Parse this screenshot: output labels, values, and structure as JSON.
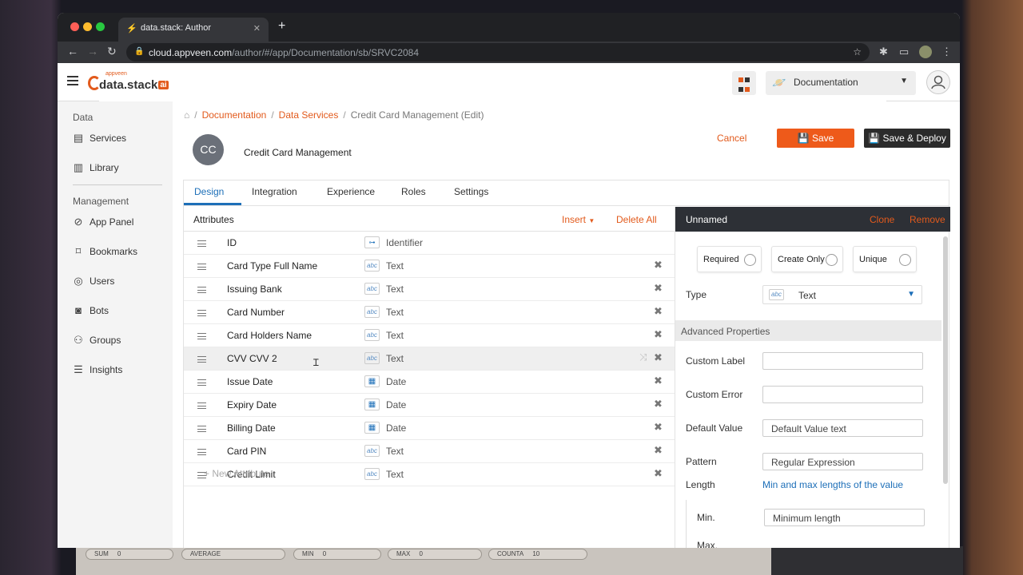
{
  "browser": {
    "tab_title": "data.stack: Author",
    "url_domain": "cloud.appveen.com",
    "url_path": "/author/#/app/Documentation/sb/SRVC2084"
  },
  "header": {
    "logo_small": "appveen",
    "logo_main": "data.stack",
    "logo_badge": "ai",
    "app_name": "Documentation",
    "accent_color": "#e25a1c"
  },
  "sidebar": {
    "data_section": "Data",
    "management_section": "Management",
    "data_items": [
      {
        "label": "Services",
        "icon": "list-icon"
      },
      {
        "label": "Library",
        "icon": "library-icon"
      }
    ],
    "management_items": [
      {
        "label": "App Panel",
        "icon": "globe-icon"
      },
      {
        "label": "Bookmarks",
        "icon": "bookmark-icon"
      },
      {
        "label": "Users",
        "icon": "user-icon"
      },
      {
        "label": "Bots",
        "icon": "bot-icon"
      },
      {
        "label": "Groups",
        "icon": "groups-icon"
      },
      {
        "label": "Insights",
        "icon": "insights-icon"
      }
    ]
  },
  "breadcrumb": {
    "home_icon": "home-icon",
    "items": [
      "Documentation",
      "Data Services"
    ],
    "current": "Credit Card Management (Edit)"
  },
  "service": {
    "initials": "CC",
    "name": "Credit Card Management"
  },
  "actions": {
    "cancel": "Cancel",
    "save": "Save",
    "save_deploy": "Save & Deploy"
  },
  "tabs": [
    "Design",
    "Integration",
    "Experience",
    "Roles",
    "Settings"
  ],
  "attributes": {
    "title": "Attributes",
    "insert": "Insert",
    "delete_all": "Delete All",
    "new_attribute": "+ New Attribute",
    "rows": [
      {
        "name": "ID",
        "type": "Identifier",
        "icon": "key-icon"
      },
      {
        "name": "Card Type Full Name",
        "type": "Text",
        "icon": "abc"
      },
      {
        "name": "Issuing Bank",
        "type": "Text",
        "icon": "abc"
      },
      {
        "name": "Card Number",
        "type": "Text",
        "icon": "abc"
      },
      {
        "name": "Card Holders Name",
        "type": "Text",
        "icon": "abc"
      },
      {
        "name": "CVV CVV 2",
        "type": "Text",
        "icon": "abc"
      },
      {
        "name": "Issue Date",
        "type": "Date",
        "icon": "calendar-icon"
      },
      {
        "name": "Expiry Date",
        "type": "Date",
        "icon": "calendar-icon"
      },
      {
        "name": "Billing Date",
        "type": "Date",
        "icon": "calendar-icon"
      },
      {
        "name": "Card PIN",
        "type": "Text",
        "icon": "abc"
      },
      {
        "name": "Credit Limit",
        "type": "Text",
        "icon": "abc"
      }
    ]
  },
  "properties": {
    "title": "Unnamed",
    "clone": "Clone",
    "remove": "Remove",
    "flags": [
      "Required",
      "Create Only",
      "Unique"
    ],
    "type_label": "Type",
    "type_value": "Text",
    "type_icon": "abc",
    "advanced": "Advanced Properties",
    "custom_label": "Custom Label",
    "custom_error": "Custom Error",
    "default_value": "Default Value",
    "default_value_placeholder": "Default Value text",
    "pattern": "Pattern",
    "pattern_placeholder": "Regular Expression",
    "length": "Length",
    "length_hint": "Min and max lengths of the value",
    "min": "Min.",
    "min_placeholder": "Minimum length",
    "max": "Max."
  },
  "background_bar": {
    "cells": [
      "SUM",
      "0",
      "AVERAGE",
      "MIN",
      "0",
      "MAX",
      "0",
      "COUNTA",
      "10"
    ]
  }
}
